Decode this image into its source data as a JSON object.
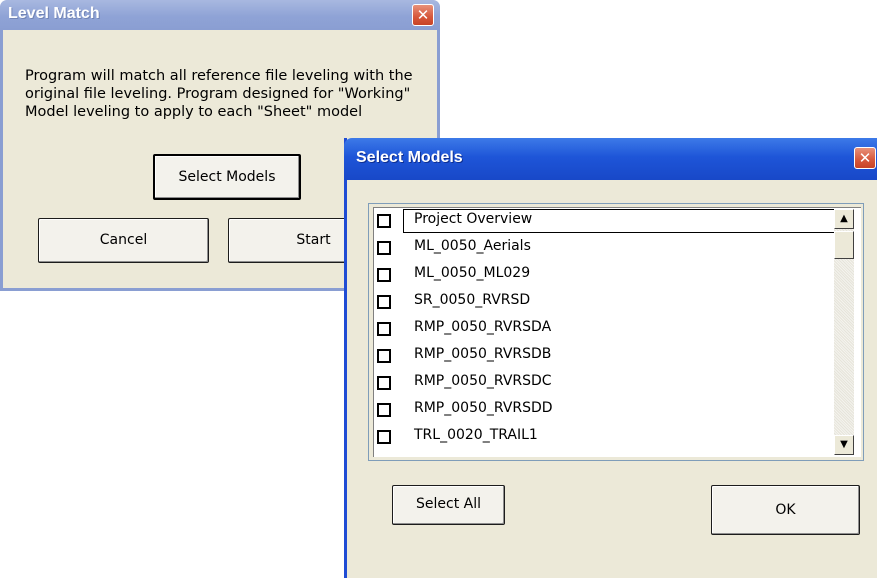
{
  "level_match": {
    "title": "Level Match",
    "close": "✕",
    "description": "Program will match all reference file leveling with the original file leveling.  Program designed for \"Working\" Model leveling to apply to each \"Sheet\" model",
    "select_models_label": "Select Models",
    "cancel_label": "Cancel",
    "start_label": "Start"
  },
  "select_models": {
    "title": "Select Models",
    "close": "✕",
    "items": [
      {
        "label": "Project Overview",
        "checked": false
      },
      {
        "label": "ML_0050_Aerials",
        "checked": false
      },
      {
        "label": "ML_0050_ML029",
        "checked": false
      },
      {
        "label": "SR_0050_RVRSD",
        "checked": false
      },
      {
        "label": "RMP_0050_RVRSDA",
        "checked": false
      },
      {
        "label": "RMP_0050_RVRSDB",
        "checked": false
      },
      {
        "label": "RMP_0050_RVRSDC",
        "checked": false
      },
      {
        "label": "RMP_0050_RVRSDD",
        "checked": false
      },
      {
        "label": "TRL_0020_TRAIL1",
        "checked": false
      }
    ],
    "scroll_up": "▲",
    "scroll_down": "▼",
    "select_all_label": "Select All",
    "ok_label": "OK"
  }
}
